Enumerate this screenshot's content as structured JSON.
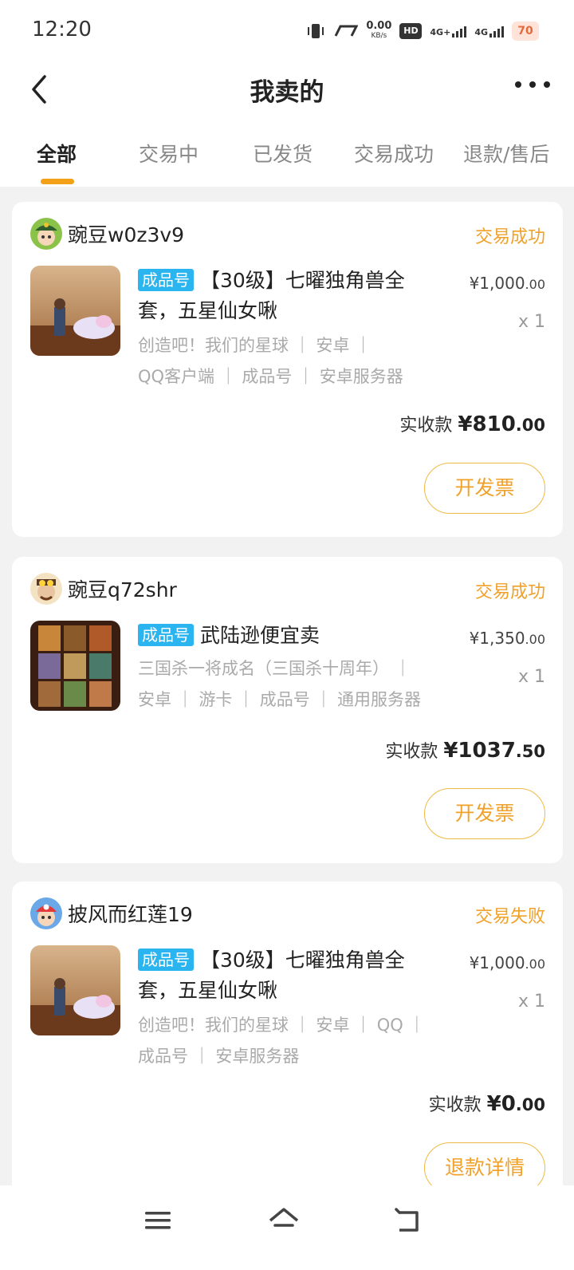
{
  "status_bar": {
    "time": "12:20",
    "speed_value": "0.00",
    "speed_unit": "KB/s",
    "network1": "4G+",
    "network2": "4G",
    "hd": "HD",
    "badge": "70"
  },
  "nav": {
    "title": "我卖的"
  },
  "tabs": [
    "全部",
    "交易中",
    "已发货",
    "交易成功",
    "退款/售后"
  ],
  "orders": [
    {
      "seller": "豌豆w0z3v9",
      "status": "交易成功",
      "tag": "成品号",
      "title": "【30级】七曜独角兽全套，五星仙女啾",
      "attrs_line1": "创造吧！我们的星球 ｜ 安卓 ｜",
      "attrs_line2": "QQ客户端 ｜ 成品号 ｜ 安卓服务器",
      "price_int": "¥1,000",
      "price_dec": ".00",
      "qty": "x 1",
      "received_label": "实收款",
      "received_int": "¥810",
      "received_dec": ".00",
      "button": "开发票"
    },
    {
      "seller": "豌豆q72shr",
      "status": "交易成功",
      "tag": "成品号",
      "title": "武陆逊便宜卖",
      "attrs_line1": "三国杀一将成名（三国杀十周年） ｜",
      "attrs_line2": "安卓 ｜ 游卡 ｜ 成品号 ｜ 通用服务器",
      "price_int": "¥1,350",
      "price_dec": ".00",
      "qty": "x 1",
      "received_label": "实收款",
      "received_int": "¥1037",
      "received_dec": ".50",
      "button": "开发票"
    },
    {
      "seller": "披风而红莲19",
      "status": "交易失败",
      "tag": "成品号",
      "title": "【30级】七曜独角兽全套，五星仙女啾",
      "attrs_line1": "创造吧！我们的星球 ｜ 安卓 ｜ QQ ｜",
      "attrs_line2": "成品号 ｜ 安卓服务器",
      "price_int": "¥1,000",
      "price_dec": ".00",
      "qty": "x 1",
      "received_label": "实收款",
      "received_int": "¥0",
      "received_dec": ".00",
      "button": "退款详情"
    }
  ],
  "colors": {
    "accent": "#f0a12a",
    "tag": "#2bb5f0"
  }
}
